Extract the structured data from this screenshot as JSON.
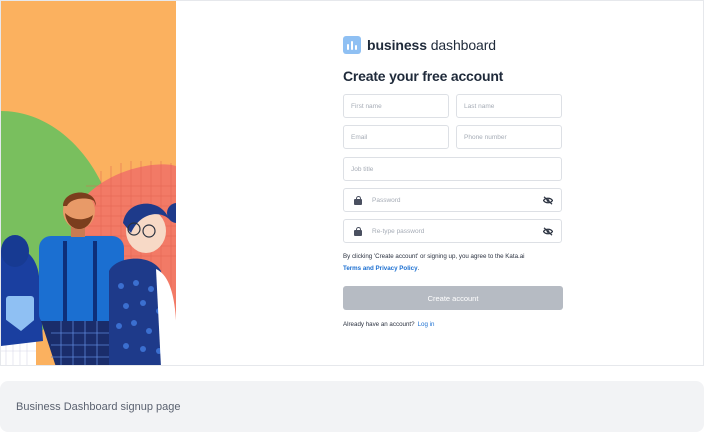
{
  "brand": {
    "bold": "business",
    "light": "dashboard",
    "color": "#8fc0f3"
  },
  "form": {
    "title": "Create your free account",
    "first_name_placeholder": "First name",
    "last_name_placeholder": "Last name",
    "email_placeholder": "Email",
    "phone_placeholder": "Phone number",
    "job_title_placeholder": "Job title",
    "password_placeholder": "Password",
    "retype_password_placeholder": "Re-type password",
    "terms_text": "By clicking 'Create account' or signing up, you agree to the Kata.ai",
    "terms_link": "Terms and Privacy Policy",
    "terms_suffix": ".",
    "submit_label": "Create account",
    "signin_prompt": "Already have an account?",
    "signin_link": "Log in"
  },
  "icons": [
    "lock-icon",
    "eye-off-icon",
    "business-dashboard-logo-icon"
  ],
  "colors": {
    "accent": "#1b6fd1",
    "button_disabled": "#b6bbc3",
    "orange": "#fbb15f",
    "green": "#79bf5e",
    "coral": "#f27a66"
  },
  "caption": "Business Dashboard signup page"
}
